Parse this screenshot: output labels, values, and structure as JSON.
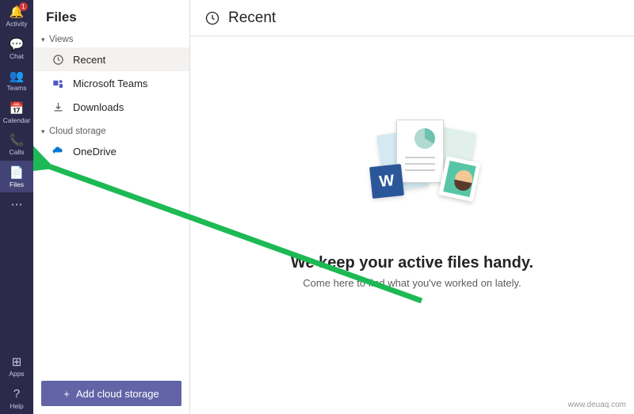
{
  "rail": {
    "items": [
      {
        "label": "Activity",
        "icon": "🔔",
        "badge": "1"
      },
      {
        "label": "Chat",
        "icon": "💬"
      },
      {
        "label": "Teams",
        "icon": "👥"
      },
      {
        "label": "Calendar",
        "icon": "📅"
      },
      {
        "label": "Calls",
        "icon": "📞"
      },
      {
        "label": "Files",
        "icon": "📄"
      },
      {
        "label": "",
        "icon": "⋯"
      }
    ],
    "bottom": [
      {
        "label": "Apps",
        "icon": "⊞"
      },
      {
        "label": "Help",
        "icon": "?"
      }
    ]
  },
  "sidebar": {
    "title": "Files",
    "sections": {
      "views": {
        "label": "Views",
        "items": [
          {
            "label": "Recent"
          },
          {
            "label": "Microsoft Teams"
          },
          {
            "label": "Downloads"
          }
        ]
      },
      "cloud": {
        "label": "Cloud storage",
        "items": [
          {
            "label": "OneDrive"
          }
        ]
      }
    },
    "add_button": "Add cloud storage"
  },
  "main": {
    "header_title": "Recent",
    "empty_title": "We keep your active files handy.",
    "empty_sub": "Come here to find what you've worked on lately."
  },
  "watermark": "www.deuaq.com"
}
